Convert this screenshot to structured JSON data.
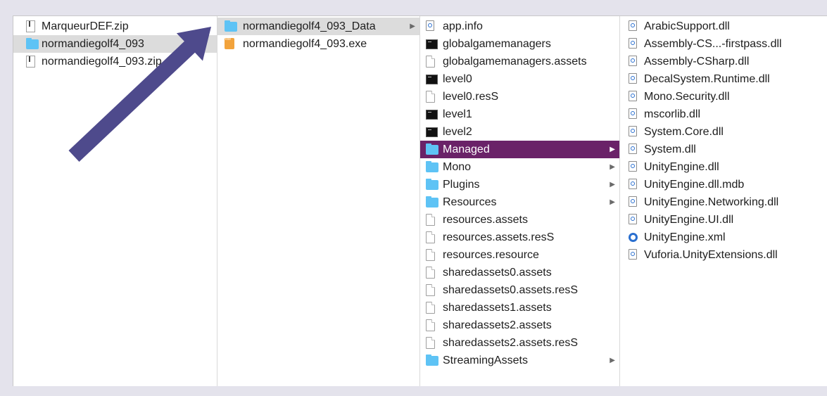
{
  "column1": [
    {
      "label": "MarqueurDEF.zip",
      "icon": "zip-file-icon",
      "selected": ""
    },
    {
      "label": "normandiegolf4_093",
      "icon": "folder-icon",
      "selected": "gray"
    },
    {
      "label": "normandiegolf4_093.zip",
      "icon": "zip-file-icon",
      "selected": ""
    }
  ],
  "column2": [
    {
      "label": "normandiegolf4_093_Data",
      "icon": "folder-icon",
      "selected": "gray",
      "chevron": "▶"
    },
    {
      "label": "normandiegolf4_093.exe",
      "icon": "exe-icon",
      "selected": ""
    }
  ],
  "column3": [
    {
      "label": "app.info",
      "icon": "dll-file-icon"
    },
    {
      "label": "globalgamemanagers",
      "icon": "terminal-file-icon"
    },
    {
      "label": "globalgamemanagers.assets",
      "icon": "document-icon"
    },
    {
      "label": "level0",
      "icon": "terminal-file-icon"
    },
    {
      "label": "level0.resS",
      "icon": "document-icon"
    },
    {
      "label": "level1",
      "icon": "terminal-file-icon"
    },
    {
      "label": "level2",
      "icon": "terminal-file-icon"
    },
    {
      "label": "Managed",
      "icon": "folder-icon",
      "selected": "purple",
      "chevron": "▶"
    },
    {
      "label": "Mono",
      "icon": "folder-icon",
      "chevron": "▶"
    },
    {
      "label": "Plugins",
      "icon": "folder-icon",
      "chevron": "▶"
    },
    {
      "label": "Resources",
      "icon": "folder-icon",
      "chevron": "▶"
    },
    {
      "label": "resources.assets",
      "icon": "document-icon"
    },
    {
      "label": "resources.assets.resS",
      "icon": "document-icon"
    },
    {
      "label": "resources.resource",
      "icon": "document-icon"
    },
    {
      "label": "sharedassets0.assets",
      "icon": "document-icon"
    },
    {
      "label": "sharedassets0.assets.resS",
      "icon": "document-icon"
    },
    {
      "label": "sharedassets1.assets",
      "icon": "document-icon"
    },
    {
      "label": "sharedassets2.assets",
      "icon": "document-icon"
    },
    {
      "label": "sharedassets2.assets.resS",
      "icon": "document-icon"
    },
    {
      "label": "StreamingAssets",
      "icon": "folder-icon",
      "chevron": "▶"
    }
  ],
  "column4": [
    {
      "label": "ArabicSupport.dll",
      "icon": "dll-file-icon"
    },
    {
      "label": "Assembly-CS...-firstpass.dll",
      "icon": "dll-file-icon"
    },
    {
      "label": "Assembly-CSharp.dll",
      "icon": "dll-file-icon"
    },
    {
      "label": "DecalSystem.Runtime.dll",
      "icon": "dll-file-icon"
    },
    {
      "label": "Mono.Security.dll",
      "icon": "dll-file-icon"
    },
    {
      "label": "mscorlib.dll",
      "icon": "dll-file-icon"
    },
    {
      "label": "System.Core.dll",
      "icon": "dll-file-icon"
    },
    {
      "label": "System.dll",
      "icon": "dll-file-icon"
    },
    {
      "label": "UnityEngine.dll",
      "icon": "dll-file-icon"
    },
    {
      "label": "UnityEngine.dll.mdb",
      "icon": "dll-file-icon"
    },
    {
      "label": "UnityEngine.Networking.dll",
      "icon": "dll-file-icon"
    },
    {
      "label": "UnityEngine.UI.dll",
      "icon": "dll-file-icon"
    },
    {
      "label": "UnityEngine.xml",
      "icon": "xml-file-icon"
    },
    {
      "label": "Vuforia.UnityExtensions.dll",
      "icon": "dll-file-icon"
    }
  ],
  "colors": {
    "selection_purple": "#6a2268",
    "selection_gray": "#dcdcdc",
    "folder_blue": "#5ec3f5",
    "annotation_arrow": "#4e4a8c"
  }
}
